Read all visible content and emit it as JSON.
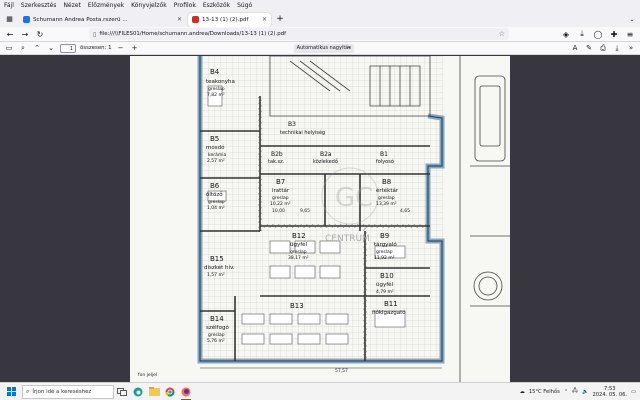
{
  "menubar": [
    "Fájl",
    "Szerkesztés",
    "Nézet",
    "Előzmények",
    "Könyvjelzők",
    "Profilok",
    "Eszközök",
    "Súgó"
  ],
  "tabs": [
    {
      "title": "Schumann Andrea Posta.rszerü ..."
    },
    {
      "title": "13-13 (1) (2).pdf"
    }
  ],
  "navbar": {
    "url": "file:///\\\\FILES01/Home/schumann.andrea/Downloads/13-13 (1) (2).pdf"
  },
  "pdf_toolbar": {
    "page_current": "1",
    "page_total_label": "összesen: 1",
    "zoom_label": "Automatikus nagyítás"
  },
  "floorplan": {
    "rooms": [
      {
        "id": "B4",
        "name": "teakonyha",
        "floor": "greslap",
        "area": "7,82 m²"
      },
      {
        "id": "B5",
        "name": "mosdó",
        "floor": "kerámia",
        "area": "2,57 m²"
      },
      {
        "id": "B6",
        "name": "öltöző",
        "floor": "greslap",
        "area": "1,04 m²"
      },
      {
        "id": "B7",
        "name": "irattár",
        "floor": "greslap",
        "area": "10,22 m²"
      },
      {
        "id": "B8",
        "name": "értéktár",
        "floor": "greslap",
        "area": "13,39 m²"
      },
      {
        "id": "B9",
        "name": "tárgyaló",
        "floor": "greslap",
        "area": "11,92 m²"
      },
      {
        "id": "B10",
        "name": "ügyfél",
        "floor": "",
        "area": "4,79 m²"
      },
      {
        "id": "B11",
        "name": "fiókigazgató",
        "floor": "",
        "area": ""
      },
      {
        "id": "B12",
        "name": "ügyfél",
        "floor": "greslap",
        "area": "38,17 m²"
      },
      {
        "id": "B13",
        "name": "",
        "floor": "",
        "area": ""
      },
      {
        "id": "B14",
        "name": "szélfogó",
        "floor": "greslap",
        "area": "5,76 m²"
      },
      {
        "id": "B15",
        "name": "diszkét hív.",
        "floor": "",
        "area": "1,57 m²"
      },
      {
        "id": "B2b",
        "name": "tak.sz.",
        "floor": "",
        "area": ""
      },
      {
        "id": "B2a",
        "name": "közlekedő",
        "floor": "",
        "area": ""
      },
      {
        "id": "B1",
        "name": "folyosó",
        "floor": "",
        "area": ""
      },
      {
        "id": "B3",
        "name": "technikai helyiség",
        "floor": "",
        "area": ""
      }
    ],
    "dims": [
      "57,57",
      "10,00",
      "9,65",
      "4,65"
    ],
    "watermark": "CENTRUM",
    "note": "fon jeljel"
  },
  "taskbar": {
    "search_placeholder": "Írjon ide a kereséshez",
    "weather": "15°C  Felhős",
    "time": "7:53",
    "date": "2024. 05. 06."
  },
  "colors": {
    "wall_accent": "#7fa7c9",
    "paper": "#f7f7f3",
    "chrome": "#f0f0f4"
  }
}
